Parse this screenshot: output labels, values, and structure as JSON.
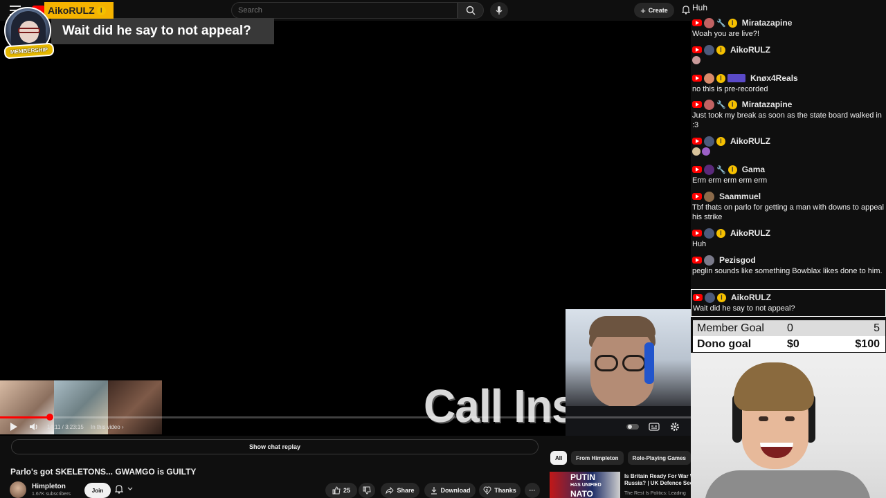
{
  "top_bar": {
    "search_placeholder": "Search",
    "create_label": "Create"
  },
  "highlight": {
    "username": "AikoRULZ",
    "message": "Wait did he say to not appeal?",
    "badge": "MEMBERSHIP"
  },
  "player": {
    "time": "14:11 / 3:23:15",
    "chapter": "In this video",
    "progress_fraction": 0.0725,
    "overlay_text": "Call Ins"
  },
  "below": {
    "chat_replay_label": "Show chat replay",
    "title": "Parlo's got SKELETONS... GWAMGO is GUILTY",
    "channel_name": "Himpleton",
    "subscribers": "1.67K subscribers",
    "join_label": "Join",
    "like_count": "25",
    "share_label": "Share",
    "download_label": "Download",
    "thanks_label": "Thanks",
    "more_label": "···"
  },
  "chips": [
    {
      "label": "All",
      "active": true
    },
    {
      "label": "From Himpleton",
      "active": false
    },
    {
      "label": "Role-Playing Games",
      "active": false
    }
  ],
  "recommendation": {
    "thumb_text_1": "PUTIN",
    "thumb_text_2": "HAS UNIFIED",
    "thumb_text_3": "NATO",
    "title_line1": "Is Britain Ready For War W",
    "title_line2": "Russia? | UK Defence Sec",
    "channel": "The Rest Is Politics: Leading"
  },
  "chat": {
    "top_partial": "Huh",
    "messages": [
      {
        "name": "Miratazapine",
        "text": "Woah you are live?!"
      },
      {
        "name": "AikoRULZ",
        "text": ""
      },
      {
        "name": "Knøx4Reals",
        "text": "no this is pre-recorded"
      },
      {
        "name": "Miratazapine",
        "text": "Just took my break as soon as the state board walked in :3"
      },
      {
        "name": "AikoRULZ",
        "text": ""
      },
      {
        "name": "Gama",
        "text": "Erm erm erm erm erm"
      },
      {
        "name": "Saammuel",
        "text": "Tbf thats on parlo for getting a man with downs to appeal his strike"
      },
      {
        "name": "AikoRULZ",
        "text": "Huh"
      },
      {
        "name": "Pezisgod",
        "text": "peglin sounds like something Bowblax likes done to him."
      },
      {
        "name": "AikoRULZ",
        "text": "Wait did he say to not appeal?"
      }
    ]
  },
  "goals": {
    "member": {
      "label": "Member Goal",
      "current": "0",
      "target": "5"
    },
    "dono": {
      "label": "Dono goal",
      "current": "$0",
      "target": "$100"
    }
  },
  "colors": {
    "accent": "#ff0000",
    "highlight_name_bg": "#f5b300",
    "chat_coin": "#f5c000"
  },
  "icons": [
    "menu-icon",
    "youtube-logo-icon",
    "search-icon",
    "mic-icon",
    "plus-icon",
    "bell-icon",
    "play-icon",
    "volume-icon",
    "miniplayer-icon",
    "captions-icon",
    "settings-icon",
    "thumbs-up-icon",
    "thumbs-down-icon",
    "share-icon",
    "download-icon",
    "thanks-icon",
    "chevron-down-icon",
    "wrench-icon",
    "coin-icon"
  ]
}
